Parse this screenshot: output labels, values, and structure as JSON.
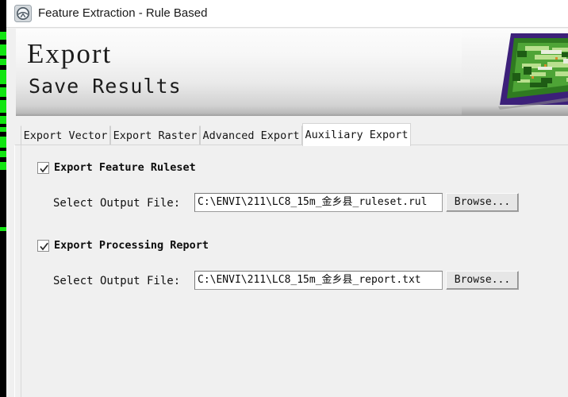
{
  "window": {
    "title": "Feature Extraction - Rule Based",
    "icon": "envi-app-icon"
  },
  "banner": {
    "title": "Export",
    "subtitle": "Save Results",
    "thumbnail_icon": "classified-raster-thumbnail"
  },
  "tabs": [
    {
      "label": "Export Vector",
      "active": false
    },
    {
      "label": "Export Raster",
      "active": false
    },
    {
      "label": "Advanced Export",
      "active": false
    },
    {
      "label": "Auxiliary Export",
      "active": true
    }
  ],
  "panel": {
    "sections": [
      {
        "checkbox_label": "Export Feature Ruleset",
        "checked": true,
        "file_label": "Select Output File:",
        "file_value": "C:\\ENVI\\211\\LC8_15m_金乡县_ruleset.rul",
        "browse_label": "Browse..."
      },
      {
        "checkbox_label": "Export Processing Report",
        "checked": true,
        "file_label": "Select Output File:",
        "file_value": "C:\\ENVI\\211\\LC8_15m_金乡县_report.txt",
        "browse_label": "Browse..."
      }
    ]
  },
  "colors": {
    "window_bg": "#f0f0f0",
    "titlebar_bg": "#ffffff",
    "active_tab_bg": "#ffffff",
    "field_bg": "#ffffff",
    "backdrop_green": "#12e512",
    "backdrop_black": "#000000"
  }
}
